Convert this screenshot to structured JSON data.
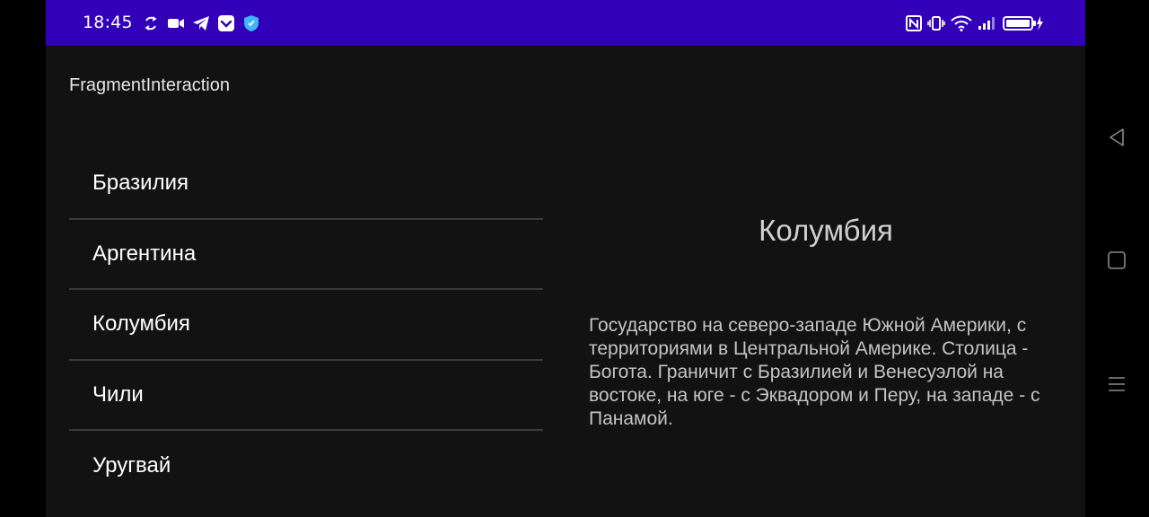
{
  "status_bar": {
    "time": "18:45",
    "left_icons": [
      "sync-icon",
      "video-camera-icon",
      "telegram-icon",
      "pocket-icon",
      "shield-icon"
    ],
    "right_icons": [
      "nfc-icon",
      "vibrate-icon",
      "wifi-icon",
      "signal-icon",
      "battery-charging-icon"
    ],
    "background_color": "#3100b8"
  },
  "app": {
    "title": "FragmentInteraction"
  },
  "country_list": {
    "items": [
      {
        "label": "Бразилия"
      },
      {
        "label": "Аргентина"
      },
      {
        "label": "Колумбия"
      },
      {
        "label": "Чили"
      },
      {
        "label": "Уругвай"
      }
    ]
  },
  "detail": {
    "title": "Колумбия",
    "description": "Государство на северо-западе Южной Америки, с территориями в Центральной Америке. Столица - Богота. Граничит с Бразилией и Венесуэлой на востоке, на юге - с Эквадором и Перу, на западе - с Панамой."
  },
  "nav_bar": {
    "buttons": [
      "back-icon",
      "home-icon",
      "recents-icon"
    ]
  }
}
